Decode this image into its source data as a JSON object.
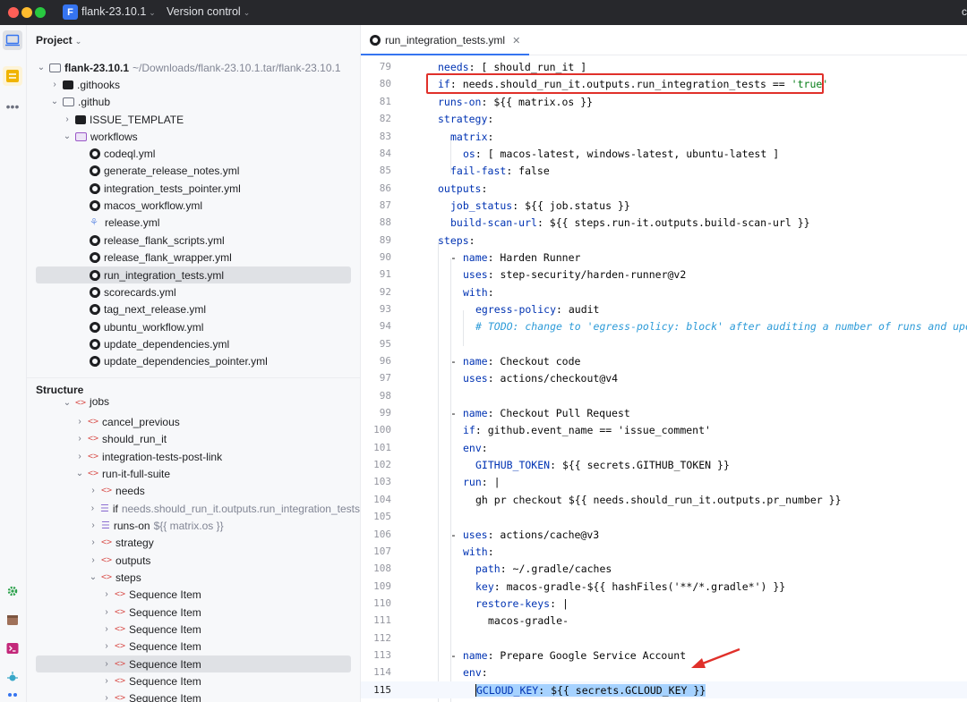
{
  "titlebar": {
    "project_badge": "F",
    "project_name": "flank-23.10.1",
    "vcs_label": "Version control",
    "right_fragment": "c"
  },
  "project_panel": {
    "title": "Project",
    "root": {
      "name": "flank-23.10.1",
      "path": "~/Downloads/flank-23.10.1.tar/flank-23.10.1"
    },
    "items": [
      ".githooks",
      ".github",
      "ISSUE_TEMPLATE",
      "workflows",
      "codeql.yml",
      "generate_release_notes.yml",
      "integration_tests_pointer.yml",
      "macos_workflow.yml",
      "release.yml",
      "release_flank_scripts.yml",
      "release_flank_wrapper.yml",
      "run_integration_tests.yml",
      "scorecards.yml",
      "tag_next_release.yml",
      "ubuntu_workflow.yml",
      "update_dependencies.yml",
      "update_dependencies_pointer.yml"
    ]
  },
  "structure_panel": {
    "title": "Structure",
    "items": [
      "jobs",
      "cancel_previous",
      "should_run_it",
      "integration-tests-post-link",
      "run-it-full-suite",
      "needs",
      "if",
      "needs.should_run_it.outputs.run_integration_tests",
      "runs-on",
      "${{ matrix.os }}",
      "strategy",
      "outputs",
      "steps",
      "Sequence Item",
      "Sequence Item",
      "Sequence Item",
      "Sequence Item",
      "Sequence Item",
      "Sequence Item",
      "Sequence Item"
    ]
  },
  "editor": {
    "tab_label": "run_integration_tests.yml",
    "line_numbers": [
      "79",
      "80",
      "81",
      "82",
      "83",
      "84",
      "85",
      "86",
      "87",
      "88",
      "89",
      "90",
      "91",
      "92",
      "93",
      "94",
      "95",
      "96",
      "97",
      "98",
      "99",
      "100",
      "101",
      "102",
      "103",
      "104",
      "105",
      "106",
      "107",
      "108",
      "109",
      "110",
      "111",
      "112",
      "113",
      "114",
      "115"
    ],
    "lines": {
      "l79_key": "needs",
      "l79_val": ": [ should_run_it ]",
      "l80_key": "if",
      "l80_val": ": needs.should_run_it.outputs.run_integration_tests == ",
      "l80_str": "'true'",
      "l81_key": "runs-on",
      "l81_val": ": ${{ matrix.os }}",
      "l82_key": "strategy",
      "l82_val": ":",
      "l83_key": "matrix",
      "l83_val": ":",
      "l84_key": "os",
      "l84_val": ": [ macos-latest, windows-latest, ubuntu-latest ]",
      "l85_key": "fail-fast",
      "l85_val": ": false",
      "l86_key": "outputs",
      "l86_val": ":",
      "l87_key": "job_status",
      "l87_val": ": ${{ job.status }}",
      "l88_key": "build-scan-url",
      "l88_val": ": ${{ steps.run-it.outputs.build-scan-url }}",
      "l89_key": "steps",
      "l89_val": ":",
      "l90_dash": "- ",
      "l90_key": "name",
      "l90_val": ": Harden Runner",
      "l91_key": "uses",
      "l91_val": ": step-security/harden-runner@v2",
      "l92_key": "with",
      "l92_val": ":",
      "l93_key": "egress-policy",
      "l93_val": ": audit",
      "l94_comment": "# TODO: change to 'egress-policy: block' after auditing a number of runs and updat",
      "l96_dash": "- ",
      "l96_key": "name",
      "l96_val": ": Checkout code",
      "l97_key": "uses",
      "l97_val": ": actions/checkout@v4",
      "l99_dash": "- ",
      "l99_key": "name",
      "l99_val": ": Checkout Pull Request",
      "l100_key": "if",
      "l100_val": ": github.event_name == 'issue_comment'",
      "l101_key": "env",
      "l101_val": ":",
      "l102_key": "GITHUB_TOKEN",
      "l102_val": ": ${{ secrets.GITHUB_TOKEN }}",
      "l103_key": "run",
      "l103_val": ": |",
      "l104_val": "gh pr checkout ${{ needs.should_run_it.outputs.pr_number }}",
      "l106_dash": "- ",
      "l106_key": "uses",
      "l106_val": ": actions/cache@v3",
      "l107_key": "with",
      "l107_val": ":",
      "l108_key": "path",
      "l108_val": ": ~/.gradle/caches",
      "l109_key": "key",
      "l109_val": ": macos-gradle-${{ hashFiles('**/*.gradle*') }}",
      "l110_key": "restore-keys",
      "l110_val": ": |",
      "l111_val": "macos-gradle-",
      "l113_dash": "- ",
      "l113_key": "name",
      "l113_val": ": Prepare Google Service Account",
      "l114_key": "env",
      "l114_val": ":",
      "l115_key": "GCLOUD_KEY",
      "l115_val": ": ${{ secrets.GCLOUD_KEY }}"
    }
  },
  "colors": {
    "accent": "#3574f0",
    "annotation_red": "#e0302a",
    "yaml_key": "#0033b3",
    "selection": "#a6d2ff"
  }
}
